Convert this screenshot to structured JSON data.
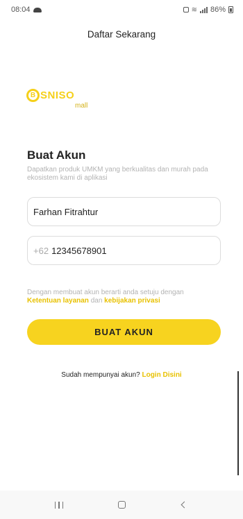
{
  "status_bar": {
    "time": "08:04",
    "battery": "86%"
  },
  "app_bar": {
    "title": "Daftar Sekarang"
  },
  "logo": {
    "brand": "BISNISO",
    "sub": "mall"
  },
  "form": {
    "heading": "Buat Akun",
    "subheading": "Dapatkan produk UMKM yang berkualitas dan murah pada ekosistem kami di aplikasi",
    "name_value": "Farhan Fitrahtur",
    "phone_prefix": "+62",
    "phone_value": "12345678901",
    "terms_text": "Dengan membuat akun berarti anda setuju dengan",
    "terms_link": "Ketentuan layanan",
    "terms_and": "dan",
    "privacy_link": "kebijakan privasi",
    "submit_label": "BUAT AKUN"
  },
  "login": {
    "prompt": "Sudah mempunyai akun?",
    "link": "Login Disini"
  },
  "colors": {
    "accent": "#f7d31f",
    "link": "#e8c100"
  }
}
